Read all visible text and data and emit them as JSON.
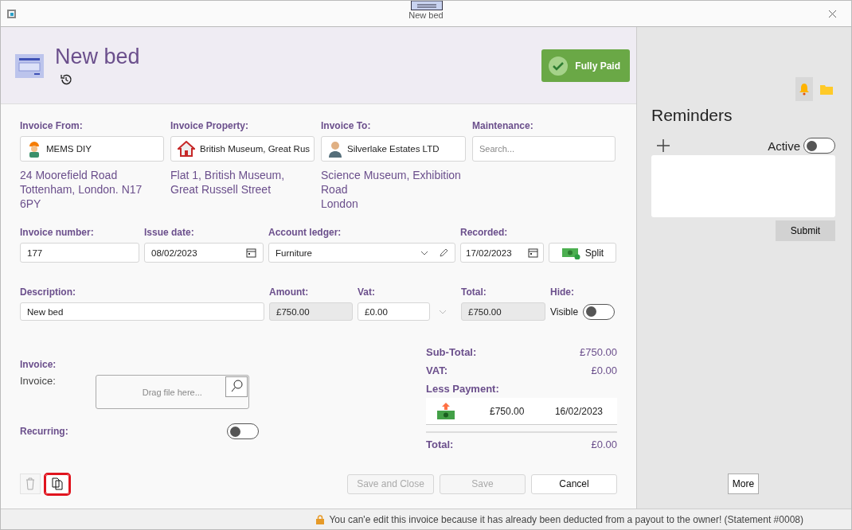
{
  "window": {
    "title": "New bed"
  },
  "header": {
    "title": "New bed",
    "badge": "Fully Paid"
  },
  "parties": [
    {
      "label": "Invoice From:",
      "value": "MEMS DIY",
      "kind": "worker",
      "address": [
        "24 Moorefield Road",
        "Tottenham, London. N17",
        "6PY"
      ]
    },
    {
      "label": "Invoice Property:",
      "value": "British Museum, Great Rus",
      "kind": "house",
      "address": [
        "Flat 1, British Museum,",
        "Great Russell Street"
      ]
    },
    {
      "label": "Invoice To:",
      "value": "Silverlake Estates LTD",
      "kind": "person",
      "address": [
        "Science Museum, Exhibition",
        "Road",
        "London"
      ]
    }
  ],
  "maintenance": {
    "label": "Maintenance:",
    "placeholder": "Search..."
  },
  "invoice_number": {
    "label": "Invoice number:",
    "value": "177"
  },
  "issue_date": {
    "label": "Issue date:",
    "value": "08/02/2023"
  },
  "account_ledger": {
    "label": "Account ledger:",
    "value": "Furniture"
  },
  "recorded": {
    "label": "Recorded:",
    "value": "17/02/2023"
  },
  "split_button": "Split",
  "description": {
    "label": "Description:",
    "value": "New bed"
  },
  "amount": {
    "label": "Amount:",
    "value": "£750.00"
  },
  "vat": {
    "label": "Vat:",
    "value": "£0.00"
  },
  "total_field": {
    "label": "Total:",
    "value": "£750.00"
  },
  "hide": {
    "label": "Hide:",
    "text": "Visible",
    "on": false
  },
  "attachment": {
    "heading": "Invoice:",
    "label": "Invoice:",
    "placeholder": "Drag file here..."
  },
  "recurring": {
    "label": "Recurring:",
    "on": false
  },
  "summary": {
    "sub_total_label": "Sub-Total:",
    "sub_total": "£750.00",
    "vat_label": "VAT:",
    "vat": "£0.00",
    "less_payment_label": "Less Payment:",
    "total_label": "Total:",
    "total": "£0.00"
  },
  "payments": [
    {
      "amount": "£750.00",
      "date": "16/02/2023"
    }
  ],
  "actions": [
    {
      "label": "Save and Close",
      "disabled": true
    },
    {
      "label": "Save",
      "disabled": true
    },
    {
      "label": "Cancel",
      "disabled": false
    }
  ],
  "copy_highlighted": true,
  "reminders": {
    "title": "Reminders",
    "active_label": "Active",
    "active": false,
    "submit": "Submit",
    "more": "More"
  },
  "status_bar": "You can'e edit this invoice because it has already been deducted from a payout to the owner! (Statement #0008)"
}
